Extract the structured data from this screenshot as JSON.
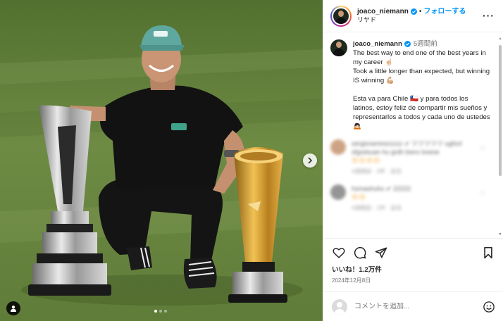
{
  "post": {
    "username": "joaco_niemann",
    "follow_label": "フォローする",
    "separator": "•",
    "location": "リヤド",
    "more_label": "···"
  },
  "caption": {
    "username": "joaco_niemann",
    "time": "5週間前",
    "lines": [
      "The best way to end one of the best years in my career ☝🏻",
      "Took a little longer than expected, but winning IS winning 💪🏼"
    ],
    "spanish": "Esta va para Chile 🇨🇱 y para todos los latinos, estoy feliz de compartir mis sueños y representarlos a todos y cada uno de ustedes 🙇🏻"
  },
  "blurred_comments": [
    {
      "text": "sergioramirezzzzz ✔ ツツツツツ ugfsvt sfgsdsuan hu grdh bwvx boeoe",
      "emoji": "😍😍😍😍",
      "meta": "4週間前  ·  3件  ·  返信"
    },
    {
      "text": "hsmashuhu ✔ 22222",
      "emoji": "😍😍",
      "meta": "4週間前  ·  1件  ·  返信"
    }
  ],
  "actions": {
    "likes": "いいね！1.2万件",
    "date": "2024年12月8日"
  },
  "comment_box": {
    "placeholder": "コメントを追加..."
  },
  "colors": {
    "accent": "#0095f6",
    "text": "#262626",
    "muted": "#737373"
  },
  "carousel": {
    "slides": 3,
    "active": 1
  }
}
